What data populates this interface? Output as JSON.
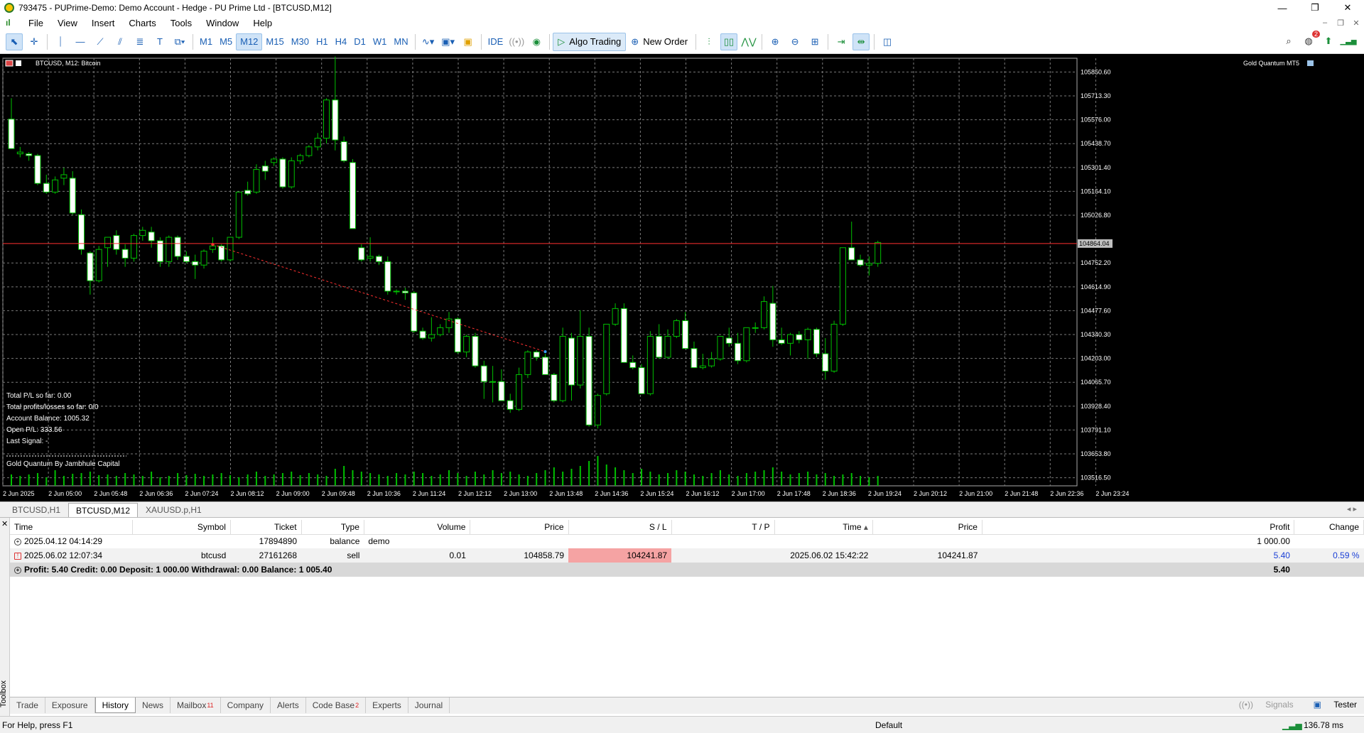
{
  "window": {
    "title": "793475 - PUPrime-Demo: Demo Account - Hedge - PU Prime Ltd - [BTCUSD,M12]",
    "minimize": "—",
    "maximize": "❐",
    "close": "✕"
  },
  "menu": [
    "File",
    "View",
    "Insert",
    "Charts",
    "Tools",
    "Window",
    "Help"
  ],
  "timeframes": [
    "M1",
    "M5",
    "M12",
    "M15",
    "M30",
    "H1",
    "H4",
    "D1",
    "W1",
    "MN"
  ],
  "selected_timeframe": "M12",
  "toolbar": {
    "ide_label": "IDE",
    "algo_label": "Algo Trading",
    "order_label": "New Order",
    "notification_count": "2"
  },
  "chart": {
    "header": "BTCUSD, M12:  Bitcoin",
    "indicator": "Gold Quantum MT5",
    "price_ticks": [
      "105850.60",
      "105713.30",
      "105576.00",
      "105438.70",
      "105301.40",
      "105164.10",
      "105026.80",
      "104752.20",
      "104614.90",
      "104477.60",
      "104340.30",
      "104203.00",
      "104065.70",
      "103928.40",
      "103791.10",
      "103653.80",
      "103516.50"
    ],
    "current_price_label": "104864.04",
    "time_ticks": [
      "2 Jun 2025",
      "2 Jun 05:00",
      "2 Jun 05:48",
      "2 Jun 06:36",
      "2 Jun 07:24",
      "2 Jun 08:12",
      "2 Jun 09:00",
      "2 Jun 09:48",
      "2 Jun 10:36",
      "2 Jun 11:24",
      "2 Jun 12:12",
      "2 Jun 13:00",
      "2 Jun 13:48",
      "2 Jun 14:36",
      "2 Jun 15:24",
      "2 Jun 16:12",
      "2 Jun 17:00",
      "2 Jun 17:48",
      "2 Jun 18:36",
      "2 Jun 19:24",
      "2 Jun 20:12",
      "2 Jun 21:00",
      "2 Jun 21:48",
      "2 Jun 22:36",
      "2 Jun 23:24"
    ],
    "info": [
      "Total P/L so far: 0.00",
      "Total profits/losses so far: 0/0",
      "Account Balance: 1005.32",
      "Open P/L: 333.56",
      "Last Signal:  -",
      "Gold Quantum By Jambhule Capital"
    ]
  },
  "chart_data": {
    "type": "candlestick",
    "symbol": "BTCUSD",
    "timeframe": "M12",
    "ylim": [
      103470,
      105930
    ],
    "current_price": 104864.04,
    "grid": true,
    "trade_line": {
      "from": [
        23,
        104858.79
      ],
      "to": [
        61,
        104241.87
      ]
    },
    "candles": [
      [
        105580,
        105700,
        105420,
        105410
      ],
      [
        105380,
        105420,
        105360,
        105390
      ],
      [
        105380,
        105390,
        105340,
        105370
      ],
      [
        105370,
        105380,
        105200,
        105210
      ],
      [
        105210,
        105260,
        105150,
        105160
      ],
      [
        105160,
        105250,
        105150,
        105230
      ],
      [
        105240,
        105300,
        105200,
        105260
      ],
      [
        105240,
        105280,
        105030,
        105040
      ],
      [
        105030,
        105060,
        104800,
        104830
      ],
      [
        104810,
        104820,
        104570,
        104650
      ],
      [
        104650,
        104850,
        104640,
        104830
      ],
      [
        104840,
        104900,
        104730,
        104900
      ],
      [
        104910,
        104940,
        104800,
        104830
      ],
      [
        104830,
        104860,
        104730,
        104780
      ],
      [
        104780,
        104920,
        104760,
        104910
      ],
      [
        104910,
        104960,
        104880,
        104940
      ],
      [
        104930,
        104960,
        104840,
        104880
      ],
      [
        104880,
        104900,
        104730,
        104760
      ],
      [
        104760,
        104910,
        104730,
        104900
      ],
      [
        104900,
        104910,
        104770,
        104790
      ],
      [
        104790,
        104820,
        104750,
        104760
      ],
      [
        104760,
        104800,
        104660,
        104740
      ],
      [
        104740,
        104830,
        104720,
        104820
      ],
      [
        104830,
        104900,
        104810,
        104850
      ],
      [
        104850,
        104860,
        104760,
        104770
      ],
      [
        104770,
        104900,
        104760,
        104900
      ],
      [
        104900,
        105160,
        104890,
        105160
      ],
      [
        105170,
        105220,
        105140,
        105150
      ],
      [
        105160,
        105320,
        105150,
        105290
      ],
      [
        105310,
        105340,
        105230,
        105280
      ],
      [
        105330,
        105360,
        105310,
        105350
      ],
      [
        105350,
        105360,
        105180,
        105190
      ],
      [
        105190,
        105360,
        105180,
        105340
      ],
      [
        105340,
        105380,
        105320,
        105370
      ],
      [
        105370,
        105430,
        105360,
        105420
      ],
      [
        105420,
        105500,
        105400,
        105470
      ],
      [
        105470,
        105700,
        105440,
        105690
      ],
      [
        105690,
        105940,
        105400,
        105460
      ],
      [
        105450,
        105480,
        105330,
        105340
      ],
      [
        105330,
        105350,
        104950,
        104950
      ],
      [
        104840,
        104860,
        104760,
        104770
      ],
      [
        104780,
        104900,
        104760,
        104790
      ],
      [
        104790,
        104800,
        104740,
        104760
      ],
      [
        104760,
        104790,
        104570,
        104590
      ],
      [
        104590,
        104600,
        104570,
        104590
      ],
      [
        104590,
        104610,
        104540,
        104580
      ],
      [
        104580,
        104590,
        104350,
        104360
      ],
      [
        104360,
        104380,
        104310,
        104320
      ],
      [
        104320,
        104440,
        104300,
        104340
      ],
      [
        104340,
        104400,
        104330,
        104380
      ],
      [
        104380,
        104470,
        104350,
        104430
      ],
      [
        104430,
        104440,
        104230,
        104240
      ],
      [
        104240,
        104340,
        104210,
        104330
      ],
      [
        104330,
        104350,
        104150,
        104160
      ],
      [
        104160,
        104190,
        103970,
        104070
      ],
      [
        104070,
        104160,
        103950,
        104070
      ],
      [
        104070,
        104140,
        103960,
        103960
      ],
      [
        103960,
        104000,
        103890,
        103910
      ],
      [
        103910,
        104150,
        103900,
        104110
      ],
      [
        104110,
        104250,
        104090,
        104240
      ],
      [
        104240,
        104250,
        104190,
        104210
      ],
      [
        104210,
        104230,
        104110,
        104110
      ],
      [
        104110,
        104120,
        103950,
        103960
      ],
      [
        103960,
        104380,
        103950,
        104330
      ],
      [
        104320,
        104350,
        103960,
        104050
      ],
      [
        104050,
        104480,
        104030,
        104330
      ],
      [
        104330,
        104380,
        103810,
        103820
      ],
      [
        103820,
        104000,
        103800,
        103990
      ],
      [
        104000,
        104400,
        103990,
        104400
      ],
      [
        104400,
        104520,
        104390,
        104490
      ],
      [
        104490,
        104520,
        104180,
        104180
      ],
      [
        104180,
        104220,
        104140,
        104150
      ],
      [
        104150,
        104170,
        104000,
        104000
      ],
      [
        104000,
        104360,
        103990,
        104330
      ],
      [
        104330,
        104400,
        104200,
        104210
      ],
      [
        104210,
        104370,
        104200,
        104330
      ],
      [
        104330,
        104430,
        104320,
        104420
      ],
      [
        104420,
        104470,
        104260,
        104260
      ],
      [
        104260,
        104300,
        104150,
        104150
      ],
      [
        104150,
        104230,
        104140,
        104160
      ],
      [
        104160,
        104240,
        104150,
        104200
      ],
      [
        104200,
        104330,
        104190,
        104330
      ],
      [
        104320,
        104380,
        104270,
        104290
      ],
      [
        104290,
        104350,
        104170,
        104190
      ],
      [
        104190,
        104380,
        104180,
        104380
      ],
      [
        104380,
        104410,
        104350,
        104380
      ],
      [
        104380,
        104560,
        104370,
        104530
      ],
      [
        104520,
        104620,
        104270,
        104310
      ],
      [
        104310,
        104380,
        104280,
        104290
      ],
      [
        104290,
        104350,
        104220,
        104340
      ],
      [
        104340,
        104360,
        104290,
        104310
      ],
      [
        104310,
        104380,
        104200,
        104370
      ],
      [
        104370,
        104380,
        104210,
        104230
      ],
      [
        104230,
        104320,
        104080,
        104130
      ],
      [
        104130,
        104420,
        104120,
        104400
      ],
      [
        104400,
        104840,
        104390,
        104840
      ],
      [
        104840,
        104990,
        104770,
        104770
      ],
      [
        104770,
        104800,
        104730,
        104740
      ],
      [
        104740,
        104790,
        104680,
        104750
      ],
      [
        104750,
        104880,
        104730,
        104870
      ]
    ],
    "volumes": [
      16,
      14,
      16,
      18,
      12,
      22,
      14,
      17,
      18,
      20,
      15,
      16,
      14,
      18,
      16,
      14,
      20,
      12,
      14,
      18,
      15,
      17,
      14,
      16,
      18,
      15,
      12,
      16,
      20,
      14,
      16,
      18,
      20,
      15,
      18,
      16,
      14,
      24,
      28,
      22,
      20,
      18,
      16,
      14,
      18,
      16,
      20,
      18,
      14,
      16,
      22,
      18,
      14,
      20,
      16,
      22,
      18,
      20,
      16,
      14,
      18,
      22,
      26,
      20,
      24,
      28,
      35,
      42,
      30,
      26,
      22,
      18,
      24,
      20,
      16,
      18,
      22,
      20,
      16,
      14,
      18,
      22,
      16,
      14,
      18,
      20,
      22,
      26,
      20,
      16,
      18,
      20,
      16,
      18,
      14,
      16,
      18,
      14,
      12,
      14
    ]
  },
  "chart_tabs": [
    "BTCUSD,H1",
    "BTCUSD,M12",
    "XAUUSD.p,H1"
  ],
  "active_chart_tab": "BTCUSD,M12",
  "history": {
    "columns": [
      "Time",
      "Symbol",
      "Ticket",
      "Type",
      "Volume",
      "Price",
      "S / L",
      "T / P",
      "Time",
      "Price",
      "Profit",
      "Change"
    ],
    "rows": [
      {
        "icon": "+",
        "time": "2025.04.12 04:14:29",
        "symbol": "",
        "ticket": "17894890",
        "type": "balance",
        "volume": "demo",
        "price": "",
        "sl": "",
        "tp": "",
        "time2": "",
        "price2": "",
        "profit": "1 000.00",
        "change": ""
      },
      {
        "icon": "!",
        "time": "2025.06.02 12:07:34",
        "symbol": "btcusd",
        "ticket": "27161268",
        "type": "sell",
        "volume": "0.01",
        "price": "104858.79",
        "sl": "104241.87",
        "tp": "",
        "time2": "2025.06.02 15:42:22",
        "price2": "104241.87",
        "profit": "5.40",
        "change": "0.59 %"
      }
    ],
    "summary": "Profit: 5.40   Credit: 0.00   Deposit: 1 000.00   Withdrawal: 0.00   Balance: 1 005.40",
    "summary_profit": "5.40"
  },
  "toolbox_label": "Toolbox",
  "bottom_tabs": [
    {
      "label": "Trade",
      "badge": ""
    },
    {
      "label": "Exposure",
      "badge": ""
    },
    {
      "label": "History",
      "badge": ""
    },
    {
      "label": "News",
      "badge": ""
    },
    {
      "label": "Mailbox",
      "badge": "11"
    },
    {
      "label": "Company",
      "badge": ""
    },
    {
      "label": "Alerts",
      "badge": ""
    },
    {
      "label": "Code Base",
      "badge": "2"
    },
    {
      "label": "Experts",
      "badge": ""
    },
    {
      "label": "Journal",
      "badge": ""
    }
  ],
  "active_bottom_tab": "History",
  "signals_label": "Signals",
  "tester_label": "Tester",
  "status": {
    "help": "For Help, press F1",
    "profile": "Default",
    "ping": "136.78 ms"
  },
  "colors": {
    "chart_bg": "#000000",
    "grid": "#7a7a7a",
    "bull": "#000000",
    "bear": "#ffffff",
    "wick": "#00c000",
    "volume": "#00c000",
    "price_line": "#ff3030",
    "sl_cell": "#f5a3a3"
  }
}
